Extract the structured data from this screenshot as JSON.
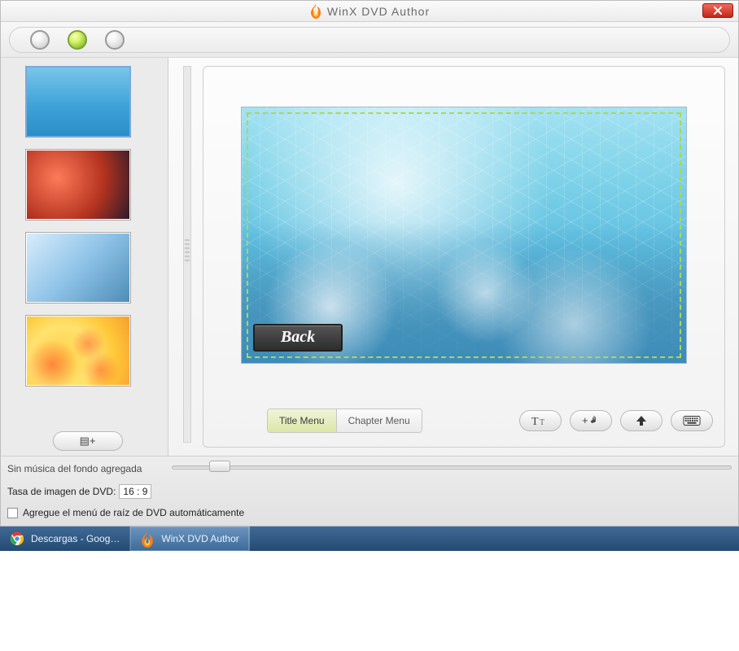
{
  "window": {
    "title": "WinX DVD Author",
    "close_icon_name": "close-icon"
  },
  "traffic_lights": {
    "states": [
      "off",
      "on",
      "off"
    ]
  },
  "sidebar": {
    "thumbnails": [
      {
        "id": "tpl-aqua",
        "selected": true
      },
      {
        "id": "tpl-red",
        "selected": false
      },
      {
        "id": "tpl-blue-stripes",
        "selected": false
      },
      {
        "id": "tpl-yellow-roses",
        "selected": false
      }
    ],
    "add_glyph": "▤+"
  },
  "preview": {
    "back_button_label": "Back"
  },
  "tabs": {
    "title_menu": "Title Menu",
    "chapter_menu": "Chapter Menu",
    "active": "title_menu"
  },
  "toolbar_icons": {
    "text": "text-icon",
    "add_music": "add-music-icon",
    "up": "up-arrow-icon",
    "keyboard": "keyboard-icon"
  },
  "status": {
    "music_line": "Sin música del fondo agregada",
    "rate_label": "Tasa de imagen de DVD:",
    "rate_value": "16 : 9",
    "auto_root_label": "Agregue el menú de raíz de DVD automáticamente",
    "auto_root_checked": false
  },
  "taskbar": {
    "items": [
      {
        "label": "Descargas - Goog…",
        "active": false,
        "icon": "chrome"
      },
      {
        "label": "WinX DVD Author",
        "active": true,
        "icon": "fire"
      }
    ]
  }
}
